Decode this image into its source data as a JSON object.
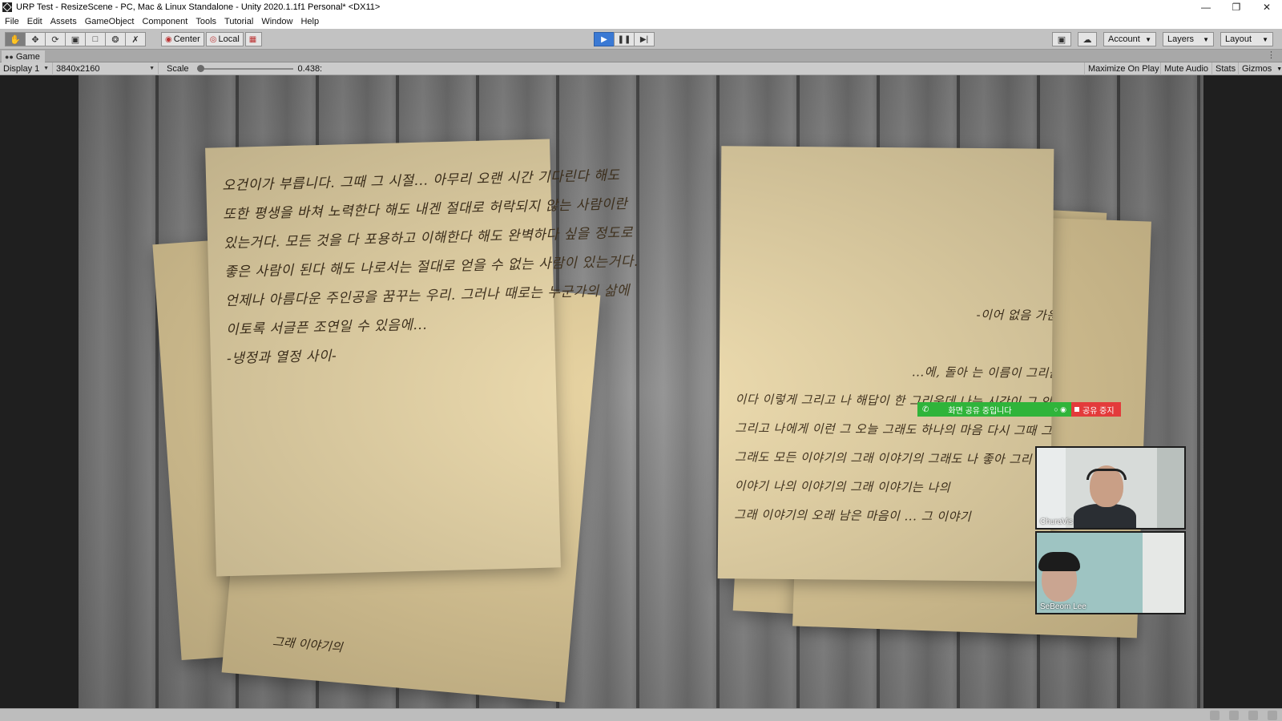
{
  "window": {
    "title": "URP Test - ResizeScene - PC, Mac & Linux Standalone - Unity 2020.1.1f1 Personal* <DX11>",
    "minimize_icon": "minimize-icon",
    "restore_icon": "restore-icon",
    "close_icon": "close-icon"
  },
  "menu": [
    "File",
    "Edit",
    "Assets",
    "GameObject",
    "Component",
    "Tools",
    "Tutorial",
    "Window",
    "Help"
  ],
  "toolbar": {
    "tools": [
      "hand-tool-icon",
      "move-tool-icon",
      "rotate-tool-icon",
      "scale-tool-icon",
      "rect-tool-icon",
      "transform-tool-icon",
      "custom-tool-icon"
    ],
    "pivot_label": "Center",
    "space_label": "Local",
    "play_state": "playing",
    "account_label": "Account",
    "layers_label": "Layers",
    "layout_label": "Layout",
    "accent_color": "#3a79d4"
  },
  "tab": {
    "label": "Game"
  },
  "game_bar": {
    "display": "Display 1",
    "resolution": "3840x2160",
    "scale_label": "Scale",
    "scale_value": "0.438:",
    "scale_fraction": 0.0,
    "maximize": "Maximize On Play",
    "mute": "Mute Audio",
    "stats": "Stats",
    "gizmos": "Gizmos"
  },
  "scene": {
    "left_letter": [
      "오건이가 부릅니다. 그때 그 시절... 아무리 오랜 시간 기다린다 해도",
      "또한 평생을 바쳐 노력한다 해도 내겐 절대로 허락되지 않는 사람이란",
      "있는거다. 모든 것을 다 포용하고 이해한다 해도 완벽하다 싶을 정도로",
      "좋은 사람이 된다 해도 나로서는 절대로 얻을 수 없는 사람이 있는거다.",
      "언제나 아름다운 주인공을 꿈꾸는 우리. 그러나 때로는 누군가의 삶에",
      "이토록 서글픈 조연일 수 있음에...",
      "",
      "-냉정과 열정 사이-"
    ],
    "right_letter": [
      "-이어 없음 가운데-",
      "...에, 돌아 는 이름이 그리움이 남아",
      "이다 이렇게 그리고 나 해답이 한 그리운데 나는 시간이 그 안에",
      "그리고 나에게 이런 그 오늘 그래도 하나의 마음 다시 그때 그 이야기 그",
      "그래도 모든 이야기의 그래 이야기의 그래도 나 좋아 그리",
      "이야기 나의 이야기의 그래 이야기는 나의",
      "그래 이야기의 오래 남은 마음이 ... 그 이야기"
    ],
    "back_paper_fragment": "그래 이야기의"
  },
  "zoom": {
    "sharing_label": "화면 공유 중입니다",
    "stop_label": "공유 중지",
    "participants": [
      "ChuraVis",
      "SeBeom Lee"
    ],
    "green": "#2fb43a",
    "red": "#e33b3b"
  }
}
